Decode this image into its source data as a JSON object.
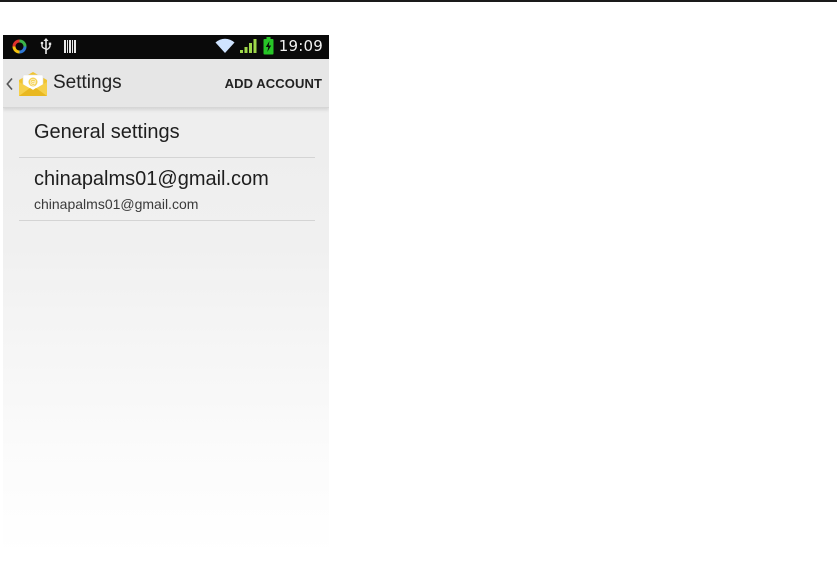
{
  "status_bar": {
    "time": "19:09",
    "icons": [
      "sync-icon",
      "usb-icon",
      "barcode-icon",
      "wifi-icon",
      "signal-icon",
      "battery-charging-icon"
    ]
  },
  "action_bar": {
    "title": "Settings",
    "action_label": "ADD ACCOUNT",
    "icons": [
      "back-chevron-icon",
      "email-app-icon"
    ]
  },
  "list": {
    "general": {
      "title": "General settings"
    },
    "account": {
      "title": "chinapalms01@gmail.com",
      "subtitle": "chinapalms01@gmail.com"
    }
  },
  "colors": {
    "status_bar_bg": "#0a0a0a",
    "action_bar_bg": "#e6e6e6",
    "battery_green": "#27c627",
    "signal_green": "#9fd84a",
    "wifi_blue": "#cfe3ff",
    "email_icon_yellow": "#f2c531"
  }
}
